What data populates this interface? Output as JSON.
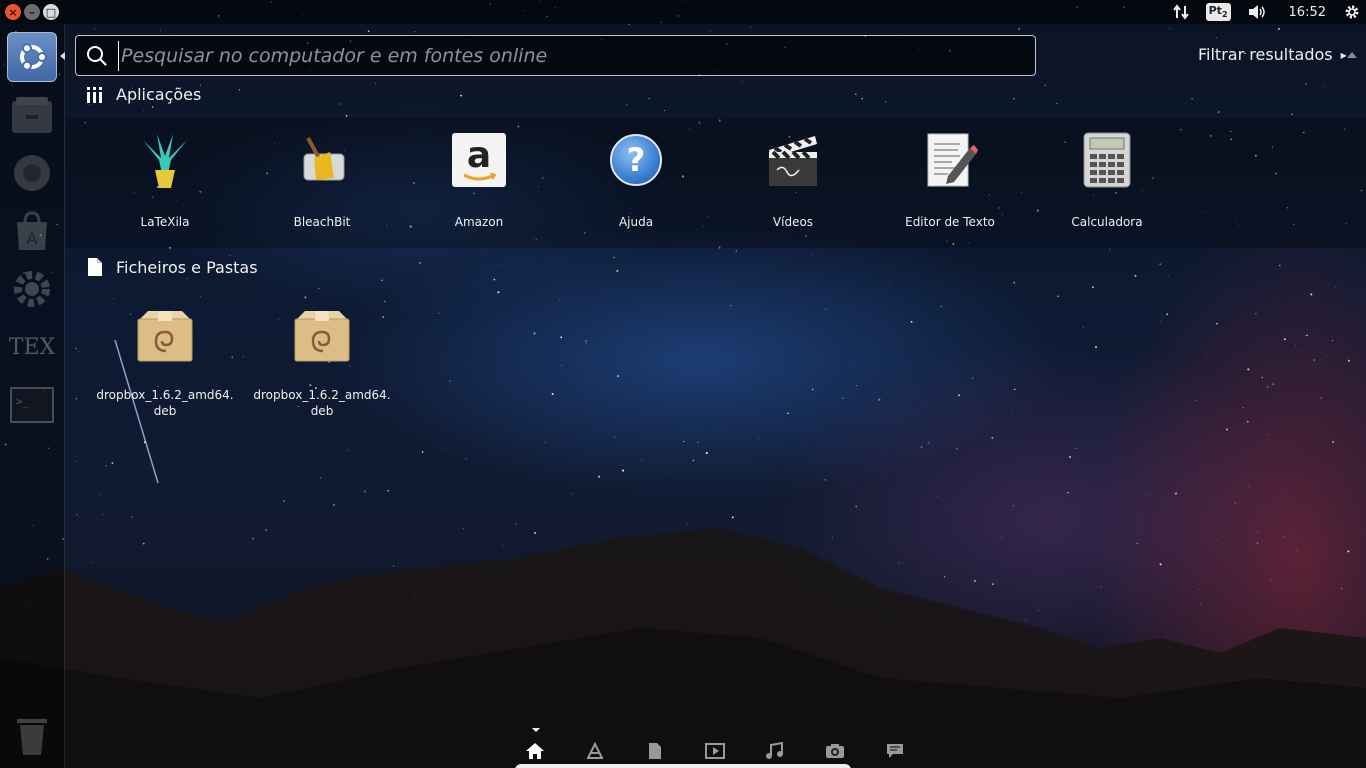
{
  "top_panel": {
    "window_buttons": {
      "close": "×",
      "minimize": "–",
      "maximize": "□"
    },
    "keyboard_layout": "Pt",
    "keyboard_layout_sub": "2",
    "clock": "16:52",
    "icons": [
      "network-icon",
      "keyboard-layout-icon",
      "volume-icon",
      "clock",
      "power-gear-icon"
    ]
  },
  "launcher": {
    "items": [
      {
        "name": "dash-home",
        "icon": "ubuntu-logo-icon"
      },
      {
        "name": "files",
        "icon": "file-manager-icon"
      },
      {
        "name": "firefox",
        "icon": "firefox-icon"
      },
      {
        "name": "software-center",
        "icon": "software-center-icon"
      },
      {
        "name": "system-settings",
        "icon": "settings-gear-icon"
      },
      {
        "name": "latex",
        "icon": "tex-icon",
        "text": "TEX"
      },
      {
        "name": "terminal",
        "icon": "terminal-icon",
        "text": ">_"
      },
      {
        "name": "trash",
        "icon": "trash-icon"
      }
    ]
  },
  "search": {
    "placeholder": "Pesquisar no computador e em fontes online",
    "value": ""
  },
  "filter": {
    "label": "Filtrar resultados",
    "arrow": "▸"
  },
  "sections": {
    "applications": {
      "title": "Aplicações",
      "items": [
        {
          "label": "LaTeXila",
          "icon": "latexila-icon"
        },
        {
          "label": "BleachBit",
          "icon": "bleachbit-icon"
        },
        {
          "label": "Amazon",
          "icon": "amazon-icon",
          "glyph": "a"
        },
        {
          "label": "Ajuda",
          "icon": "help-icon",
          "glyph": "?"
        },
        {
          "label": "Vídeos",
          "icon": "videos-icon"
        },
        {
          "label": "Editor de Texto",
          "icon": "text-editor-icon"
        },
        {
          "label": "Calculadora",
          "icon": "calculator-icon"
        }
      ]
    },
    "files": {
      "title": "Ficheiros e Pastas",
      "items": [
        {
          "label": "dropbox_1.6.2_amd64.deb",
          "icon": "deb-package-icon"
        },
        {
          "label": "dropbox_1.6.2_amd64.deb",
          "icon": "deb-package-icon"
        }
      ]
    }
  },
  "lenses": [
    {
      "name": "home",
      "icon": "home-icon",
      "active": true
    },
    {
      "name": "applications",
      "icon": "applications-lens-icon"
    },
    {
      "name": "files",
      "icon": "files-lens-icon"
    },
    {
      "name": "video",
      "icon": "video-lens-icon"
    },
    {
      "name": "music",
      "icon": "music-lens-icon"
    },
    {
      "name": "photos",
      "icon": "photo-lens-icon"
    },
    {
      "name": "social",
      "icon": "social-lens-icon"
    }
  ],
  "colors": {
    "close_button": "#e8542b",
    "launcher_home": "#3f67a6",
    "amazon_orange": "#f3a21d",
    "help_blue": "#3a7fd0"
  }
}
